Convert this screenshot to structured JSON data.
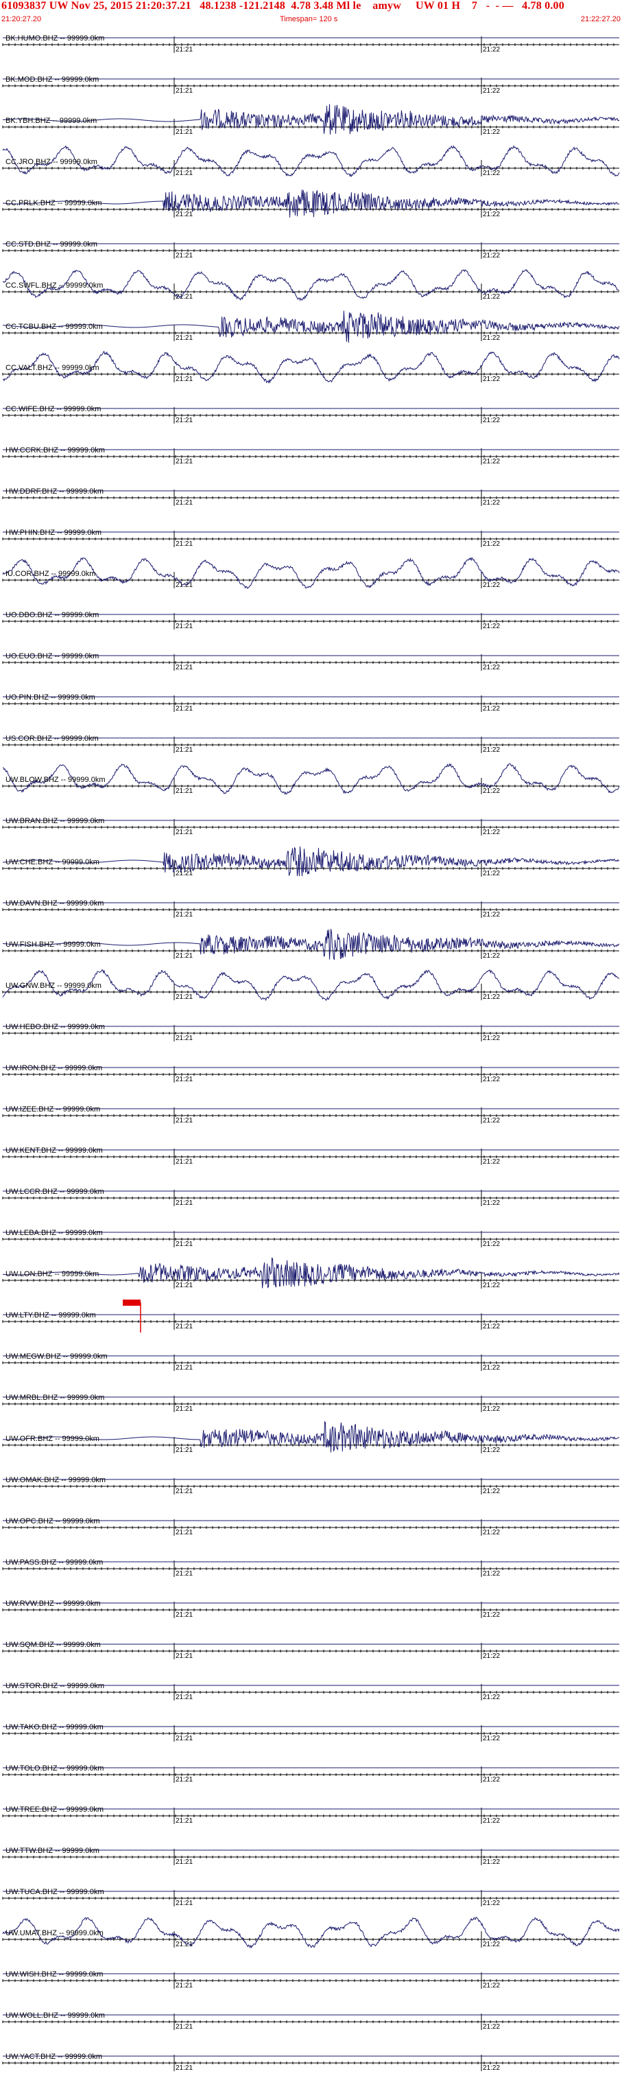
{
  "header": {
    "event_line": "61093837 UW Nov 25, 2015 21:20:37.21   48.1238 -121.2148  4.78 3.48 Ml le    amyw     UW 01 H    7   -  - —   4.78 0.00",
    "start_time": "21:20:27.20",
    "timespan": "Timespan= 120 s",
    "end_time": "21:22:27.20"
  },
  "colors": {
    "header_text": "#e00000",
    "trace": "#1a1a6e",
    "baseline": "#000000",
    "pick_flag": "#e00000"
  },
  "chart_data": {
    "type": "line",
    "title": "",
    "xlabel": "",
    "ylabel": "",
    "x_tick_labels": [
      "21:21",
      "21:22"
    ],
    "timespan_seconds": 120,
    "pick": {
      "station_index": 31,
      "label": "P"
    },
    "stations": [
      {
        "label": "BK.HUMO.BHZ -- 99999.0km",
        "activity": "flat"
      },
      {
        "label": "BK.MOD.BHZ -- 99999.0km",
        "activity": "flat"
      },
      {
        "label": "BK.YBH.BHZ -- 99999.0km",
        "activity": "event_small"
      },
      {
        "label": "CC.JRO.BHZ -- 99999.0km",
        "activity": "noise_large"
      },
      {
        "label": "CC.PRLK.BHZ -- 99999.0km",
        "activity": "event_small"
      },
      {
        "label": "CC.STD.BHZ -- 99999.0km",
        "activity": "flat"
      },
      {
        "label": "CC.SWFL.BHZ -- 99999.0km",
        "activity": "noise_large"
      },
      {
        "label": "CC.TCBU.BHZ -- 99999.0km",
        "activity": "event_large"
      },
      {
        "label": "CC.VALT.BHZ -- 99999.0km",
        "activity": "noise_large"
      },
      {
        "label": "CC.WIFE.BHZ -- 99999.0km",
        "activity": "flat"
      },
      {
        "label": "HW.CCRK.BHZ -- 99999.0km",
        "activity": "flat"
      },
      {
        "label": "HW.DDRF.BHZ -- 99999.0km",
        "activity": "flat"
      },
      {
        "label": "HW.PHIN.BHZ -- 99999.0km",
        "activity": "flat"
      },
      {
        "label": "IU.COR.BHZ -- 99999.0km",
        "activity": "noise_large"
      },
      {
        "label": "UO.DBO.BHZ -- 99999.0km",
        "activity": "flat"
      },
      {
        "label": "UO.EUO.BHZ -- 99999.0km",
        "activity": "flat"
      },
      {
        "label": "UO.PIN.BHZ -- 99999.0km",
        "activity": "flat"
      },
      {
        "label": "US.COR.BHZ -- 99999.0km",
        "activity": "flat"
      },
      {
        "label": "UW.BLOW.BHZ -- 99999.0km",
        "activity": "noise_large"
      },
      {
        "label": "UW.BRAN.BHZ -- 99999.0km",
        "activity": "flat"
      },
      {
        "label": "UW.CHE.BHZ -- 99999.0km",
        "activity": "event_large"
      },
      {
        "label": "UW.DAVN.BHZ -- 99999.0km",
        "activity": "flat"
      },
      {
        "label": "UW.FISH.BHZ -- 99999.0km",
        "activity": "event_large"
      },
      {
        "label": "UW.GNW.BHZ -- 99999.0km",
        "activity": "noise_large"
      },
      {
        "label": "UW.HEBO.BHZ -- 99999.0km",
        "activity": "flat"
      },
      {
        "label": "UW.IRON.BHZ -- 99999.0km",
        "activity": "flat"
      },
      {
        "label": "UW.IZEE.BHZ -- 99999.0km",
        "activity": "flat"
      },
      {
        "label": "UW.KENT.BHZ -- 99999.0km",
        "activity": "flat"
      },
      {
        "label": "UW.LCCR.BHZ -- 99999.0km",
        "activity": "flat"
      },
      {
        "label": "UW.LEBA.BHZ -- 99999.0km",
        "activity": "flat"
      },
      {
        "label": "UW.LON.BHZ -- 99999.0km",
        "activity": "event_picked"
      },
      {
        "label": "UW.LTY.BHZ -- 99999.0km",
        "activity": "flat"
      },
      {
        "label": "UW.MEGW.BHZ -- 99999.0km",
        "activity": "flat"
      },
      {
        "label": "UW.MRBL.BHZ -- 99999.0km",
        "activity": "flat"
      },
      {
        "label": "UW.OFR.BHZ -- 99999.0km",
        "activity": "event_large"
      },
      {
        "label": "UW.OMAK.BHZ -- 99999.0km",
        "activity": "flat"
      },
      {
        "label": "UW.OPC.BHZ -- 99999.0km",
        "activity": "flat"
      },
      {
        "label": "UW.PASS.BHZ -- 99999.0km",
        "activity": "flat"
      },
      {
        "label": "UW.RVW.BHZ -- 99999.0km",
        "activity": "flat"
      },
      {
        "label": "UW.SQM.BHZ -- 99999.0km",
        "activity": "flat"
      },
      {
        "label": "UW.STOR.BHZ -- 99999.0km",
        "activity": "flat"
      },
      {
        "label": "UW.TAKO.BHZ -- 99999.0km",
        "activity": "flat"
      },
      {
        "label": "UW.TOLO.BHZ -- 99999.0km",
        "activity": "flat"
      },
      {
        "label": "UW.TREE.BHZ -- 99999.0km",
        "activity": "flat"
      },
      {
        "label": "UW.TTW.BHZ -- 99999.0km",
        "activity": "flat"
      },
      {
        "label": "UW.TUCA.BHZ -- 99999.0km",
        "activity": "flat"
      },
      {
        "label": "UW.UMAT.BHZ -- 99999.0km",
        "activity": "noise_large"
      },
      {
        "label": "UW.WISH.BHZ -- 99999.0km",
        "activity": "flat"
      },
      {
        "label": "UW.WOLL.BHZ -- 99999.0km",
        "activity": "flat"
      },
      {
        "label": "UW.YACT.BHZ -- 99999.0km",
        "activity": "flat"
      }
    ]
  }
}
